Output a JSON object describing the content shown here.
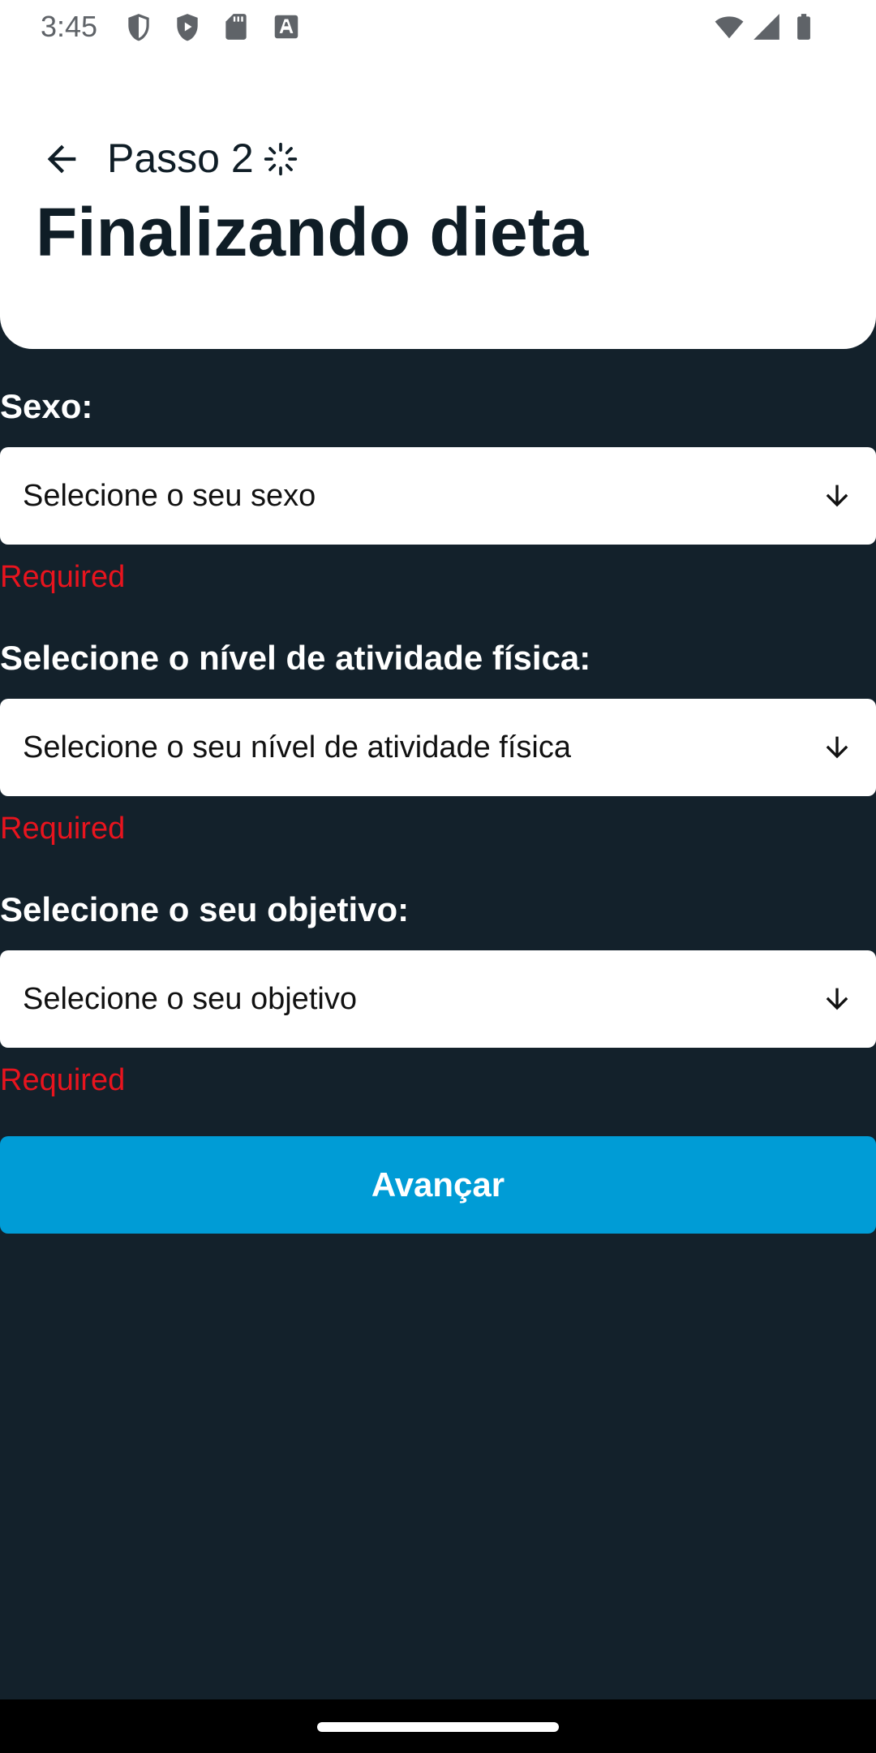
{
  "status_bar": {
    "time": "3:45",
    "icons_left": [
      "shield-icon",
      "play-shield-icon",
      "sd-card-icon",
      "font-download-icon"
    ],
    "icons_right": [
      "wifi-icon",
      "signal-icon",
      "battery-icon"
    ]
  },
  "header": {
    "step": "Passo 2",
    "title": "Finalizando dieta",
    "back_icon": "arrow-back-icon",
    "step_icon": "spinner-icon"
  },
  "form": {
    "sex": {
      "label": "Sexo:",
      "placeholder": "Selecione o seu sexo",
      "error": "Required"
    },
    "activity": {
      "label": "Selecione o nível de atividade física:",
      "placeholder": "Selecione o seu nível de atividade física",
      "error": "Required"
    },
    "goal": {
      "label": "Selecione o seu objetivo:",
      "placeholder": "Selecione o seu objetivo",
      "error": "Required"
    },
    "submit_label": "Avançar"
  },
  "colors": {
    "background": "#13212b",
    "header_bg": "#ffffff",
    "accent": "#009cd6",
    "error": "#e8141e",
    "title_text": "#0f1d26"
  }
}
